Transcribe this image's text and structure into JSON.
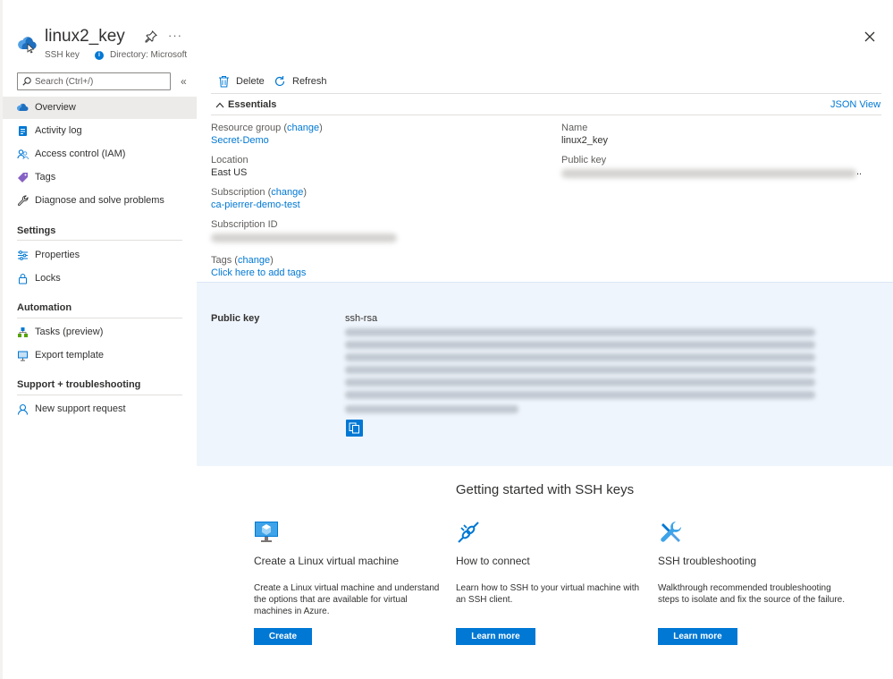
{
  "header": {
    "title": "linux2_key",
    "resource_type": "SSH key",
    "directory": "Directory: Microsoft",
    "more": "···"
  },
  "search": {
    "placeholder": "Search (Ctrl+/)"
  },
  "sidebar": {
    "collapse": "«",
    "items": [
      {
        "label": "Overview",
        "icon": "cloud-key-icon"
      },
      {
        "label": "Activity log",
        "icon": "activity-log-icon"
      },
      {
        "label": "Access control (IAM)",
        "icon": "people-icon"
      },
      {
        "label": "Tags",
        "icon": "tag-icon"
      },
      {
        "label": "Diagnose and solve problems",
        "icon": "wrench-icon"
      }
    ],
    "sections": [
      {
        "title": "Settings",
        "items": [
          {
            "label": "Properties",
            "icon": "properties-icon"
          },
          {
            "label": "Locks",
            "icon": "lock-icon"
          }
        ]
      },
      {
        "title": "Automation",
        "items": [
          {
            "label": "Tasks (preview)",
            "icon": "tasks-icon"
          },
          {
            "label": "Export template",
            "icon": "export-template-icon"
          }
        ]
      },
      {
        "title": "Support + troubleshooting",
        "items": [
          {
            "label": "New support request",
            "icon": "support-icon"
          }
        ]
      }
    ]
  },
  "toolbar": {
    "delete_label": "Delete",
    "refresh_label": "Refresh"
  },
  "essentials": {
    "header": "Essentials",
    "json_view": "JSON View",
    "resource_group_label": "Resource group",
    "change": "change",
    "resource_group_value": "Secret-Demo",
    "location_label": "Location",
    "location_value": "East US",
    "subscription_label": "Subscription",
    "subscription_value": "ca-pierrer-demo-test",
    "subscription_id_label": "Subscription ID",
    "tags_label": "Tags",
    "tags_value": "Click here to add tags",
    "name_label": "Name",
    "name_value": "linux2_key",
    "public_key_label": "Public key",
    "public_key_ellipsis": ".."
  },
  "public_key_panel": {
    "label": "Public key",
    "key_type": "ssh-rsa"
  },
  "getting_started": {
    "title": "Getting started with SSH keys",
    "cards": [
      {
        "icon": "virtual-machine-icon",
        "title": "Create a Linux virtual machine",
        "description": "Create a Linux virtual machine and understand the options that are available for virtual machines in Azure.",
        "button": "Create"
      },
      {
        "icon": "plug-connect-icon",
        "title": "How to connect",
        "description": "Learn how to SSH to your virtual machine with an SSH client.",
        "button": "Learn more"
      },
      {
        "icon": "tools-icon",
        "title": "SSH troubleshooting",
        "description": "Walkthrough recommended troubleshooting steps to isolate and fix the source of the failure.",
        "button": "Learn more"
      }
    ]
  },
  "colors": {
    "accent": "#0078d4",
    "selected_nav": "#edebe9",
    "panel_bg": "#eff5fc"
  }
}
